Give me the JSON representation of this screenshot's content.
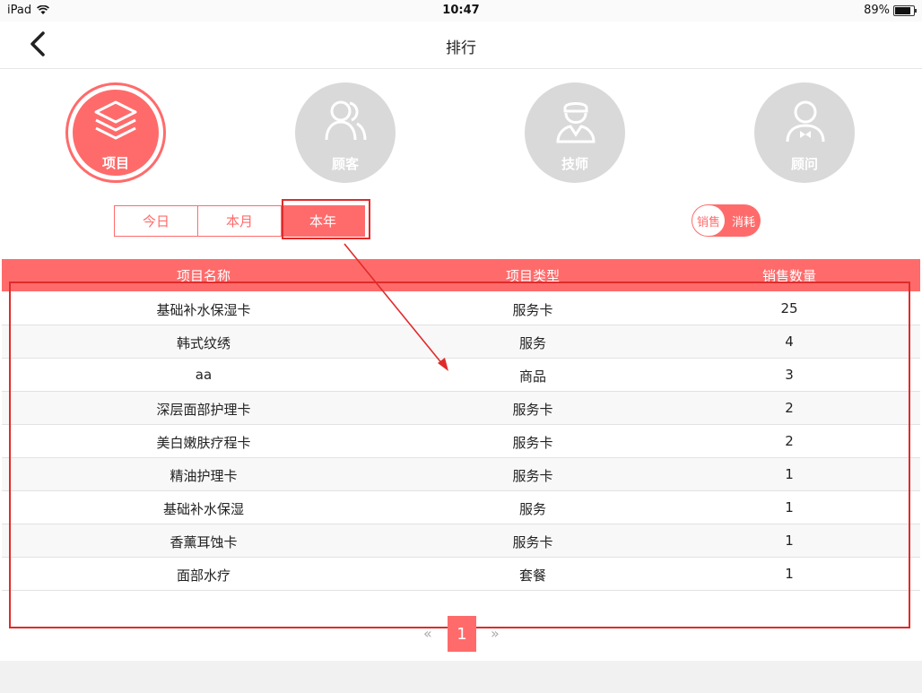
{
  "statusbar": {
    "device": "iPad",
    "time": "10:47",
    "battery": "89%"
  },
  "nav": {
    "title": "排行"
  },
  "categories": [
    {
      "label": "项目",
      "icon": "layers-icon",
      "active": true
    },
    {
      "label": "顾客",
      "icon": "users-icon",
      "active": false
    },
    {
      "label": "技师",
      "icon": "technician-icon",
      "active": false
    },
    {
      "label": "顾问",
      "icon": "consultant-icon",
      "active": false
    }
  ],
  "periods": [
    {
      "label": "今日"
    },
    {
      "label": "本月"
    },
    {
      "label": "本年"
    }
  ],
  "selected_period": "本年",
  "toggle": {
    "left": "销售",
    "right": "消耗"
  },
  "table": {
    "headers": [
      "项目名称",
      "项目类型",
      "销售数量"
    ],
    "rows": [
      [
        "基础补水保湿卡",
        "服务卡",
        "25"
      ],
      [
        "韩式纹绣",
        "服务",
        "4"
      ],
      [
        "aa",
        "商品",
        "3"
      ],
      [
        "深层面部护理卡",
        "服务卡",
        "2"
      ],
      [
        "美白嫩肤疗程卡",
        "服务卡",
        "2"
      ],
      [
        "精油护理卡",
        "服务卡",
        "1"
      ],
      [
        "基础补水保湿",
        "服务",
        "1"
      ],
      [
        "香薰耳蚀卡",
        "服务卡",
        "1"
      ],
      [
        "面部水疗",
        "套餐",
        "1"
      ]
    ]
  },
  "pager": {
    "prev": "«",
    "current": "1",
    "next": "»"
  },
  "colors": {
    "accent": "#ff6b6b",
    "inactive": "#d9d9d9",
    "annotation": "#e02b2b"
  }
}
